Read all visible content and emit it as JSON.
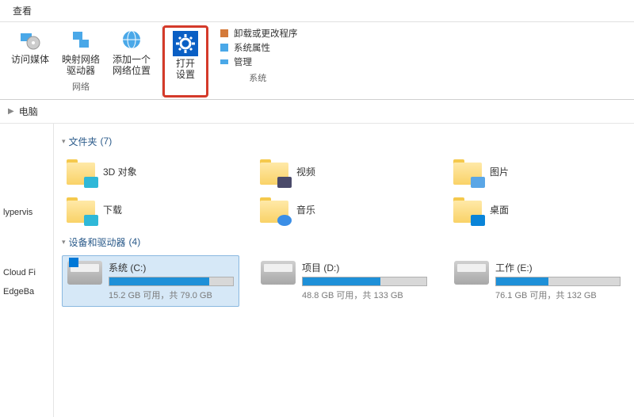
{
  "tab": {
    "view": "查看"
  },
  "ribbon": {
    "network": {
      "access_media": "访问媒体",
      "map_drive": "映射网络\n驱动器",
      "add_location": "添加一个\n网络位置",
      "group_label": "网络"
    },
    "settings": {
      "open_settings": "打开\n设置"
    },
    "system": {
      "uninstall": "卸载或更改程序",
      "properties": "系统属性",
      "manage": "管理",
      "group_label": "系统"
    }
  },
  "breadcrumb": {
    "computer": "电脑"
  },
  "sidebar": {
    "items": [
      "lypervis",
      "",
      "Cloud Fi",
      "EdgeBa"
    ]
  },
  "sections": {
    "folders": {
      "label": "文件夹",
      "count": "(7)"
    },
    "drives": {
      "label": "设备和驱动器",
      "count": "(4)"
    }
  },
  "folders": [
    {
      "name": "3D 对象",
      "overlay": "overlay-3d"
    },
    {
      "name": "视频",
      "overlay": "overlay-video"
    },
    {
      "name": "图片",
      "overlay": "overlay-pic"
    },
    {
      "name": "下载",
      "overlay": "overlay-dl"
    },
    {
      "name": "音乐",
      "overlay": "overlay-music"
    },
    {
      "name": "桌面",
      "overlay": "overlay-desk"
    }
  ],
  "drives": [
    {
      "name": "系统 (C:)",
      "free": "15.2 GB 可用，共 79.0 GB",
      "pct": 81,
      "selected": true,
      "win": true
    },
    {
      "name": "项目 (D:)",
      "free": "48.8 GB 可用，共 133 GB",
      "pct": 63,
      "selected": false,
      "win": false
    },
    {
      "name": "工作 (E:)",
      "free": "76.1 GB 可用，共 132 GB",
      "pct": 42,
      "selected": false,
      "win": false
    }
  ]
}
